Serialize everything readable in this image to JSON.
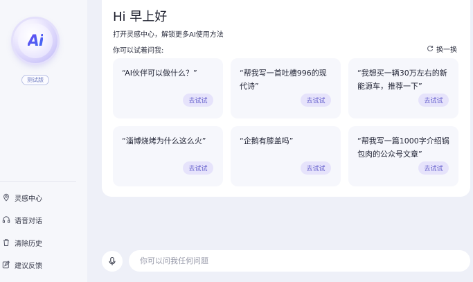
{
  "sidebar": {
    "logo_text": "Ai",
    "beta_label": "测试版",
    "items": [
      {
        "label": "灵感中心",
        "icon": "location-pin-icon"
      },
      {
        "label": "语音对话",
        "icon": "headphones-icon"
      },
      {
        "label": "清除历史",
        "icon": "trash-icon"
      },
      {
        "label": "建议反馈",
        "icon": "edit-icon"
      }
    ]
  },
  "main": {
    "greeting": "Hi 早上好",
    "subtitle": "打开灵感中心，解锁更多AI使用方法",
    "try_ask": "你可以试着问我:",
    "refresh_label": "换一换",
    "try_button_label": "去试试",
    "cards": [
      {
        "text": "“AI伙伴可以做什么？”"
      },
      {
        "text": "“帮我写一首吐槽996的现代诗”"
      },
      {
        "text": "“我想买一辆30万左右的新能源车，推荐一下”"
      },
      {
        "text": "“淄博烧烤为什么这么火”"
      },
      {
        "text": "“企鹅有膝盖吗”"
      },
      {
        "text": "“帮我写一篇1000字介绍锅包肉的公众号文章”"
      }
    ]
  },
  "input": {
    "placeholder": "你可以问我任何问题"
  },
  "colors": {
    "accent": "#5b55c9",
    "background": "#eef0f8",
    "card": "#f6f7fc"
  }
}
